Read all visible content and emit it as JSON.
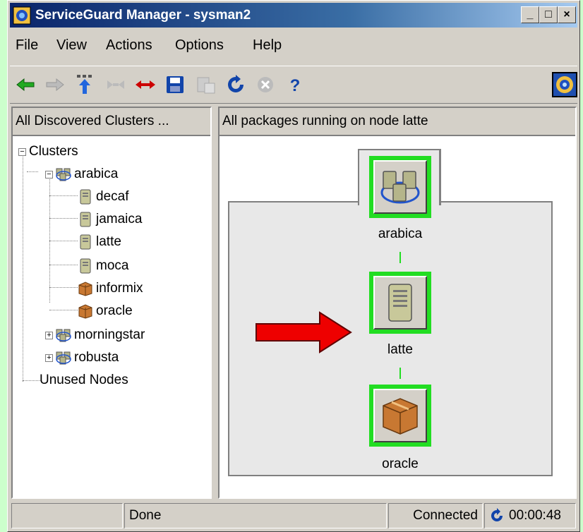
{
  "window": {
    "title": "ServiceGuard Manager - sysman2",
    "minimize": "_",
    "maximize": "□",
    "close": "×"
  },
  "menu": [
    "File",
    "View",
    "Actions",
    "Options",
    "Help"
  ],
  "toolbar": [
    {
      "icon": "back-arrow-icon",
      "color": "#22aa22",
      "enabled": true
    },
    {
      "icon": "forward-arrow-icon",
      "color": "#999999",
      "enabled": false
    },
    {
      "icon": "up-level-icon",
      "color": "#2266dd",
      "enabled": true
    },
    {
      "icon": "collapse-icon",
      "color": "#999999",
      "enabled": false
    },
    {
      "icon": "expand-icon",
      "color": "#cc0000",
      "enabled": true
    },
    {
      "icon": "save-icon",
      "color": "#1144aa",
      "enabled": true
    },
    {
      "icon": "properties-icon",
      "color": "#999999",
      "enabled": false
    },
    {
      "icon": "refresh-icon",
      "color": "#1144aa",
      "enabled": true
    },
    {
      "icon": "stop-icon",
      "color": "#999999",
      "enabled": false
    },
    {
      "icon": "help-icon",
      "color": "#1144aa",
      "enabled": true
    }
  ],
  "left_panel": {
    "header": "All Discovered Clusters ...",
    "tree": {
      "root": "Clusters",
      "cluster_open": "arabica",
      "nodes": [
        "decaf",
        "jamaica",
        "latte",
        "moca"
      ],
      "packages": [
        "informix",
        "oracle"
      ],
      "clusters_closed": [
        "morningstar",
        "robusta"
      ],
      "unused": "Unused Nodes",
      "expand_sign": "+",
      "collapse_sign": "−"
    }
  },
  "right_panel": {
    "header": "All packages running on node latte",
    "graph": {
      "cluster": "arabica",
      "node": "latte",
      "package": "oracle",
      "status_color": "#22dd22",
      "arrow_color": "#ee0000"
    }
  },
  "status": {
    "left": "",
    "message": "Done",
    "connection": "Connected",
    "timer": "00:00:48"
  }
}
